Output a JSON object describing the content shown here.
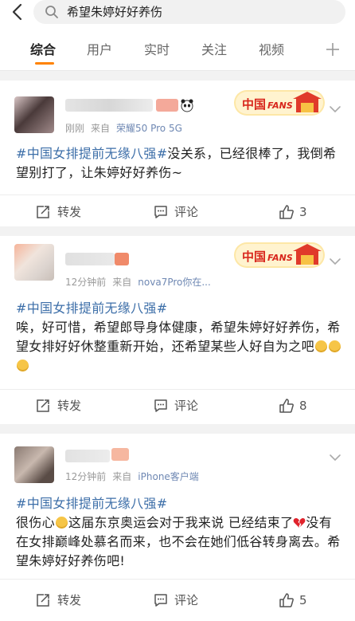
{
  "search": {
    "query": "希望朱婷好好养伤"
  },
  "tabs": [
    {
      "label": "综合",
      "active": true
    },
    {
      "label": "用户",
      "active": false
    },
    {
      "label": "实时",
      "active": false
    },
    {
      "label": "关注",
      "active": false
    },
    {
      "label": "视频",
      "active": false
    }
  ],
  "accent_color": "#ff8200",
  "hashtag_color": "#3c6ea8",
  "posts": [
    {
      "time": "刚刚",
      "source_label": "来自",
      "source": "荣耀50 Pro 5G",
      "has_fans_badge": true,
      "hashtag": "#中国女排提前无缘八强#",
      "text_after_hashtag": "没关系，已经很棒了，我倒希望别打了，让朱婷好好养伤~",
      "actions": {
        "repost": "转发",
        "comment": "评论",
        "like_count": "3"
      }
    },
    {
      "time": "12分钟前",
      "source_label": "来自",
      "source": "nova7Pro你在...",
      "has_fans_badge": true,
      "hashtag": "#中国女排提前无缘八强#",
      "text_after_hashtag": "唉，好可惜，希望郎导身体健康，希望朱婷好好养伤，希望女排好好休整重新开始，还希望某些人好自为之吧",
      "actions": {
        "repost": "转发",
        "comment": "评论",
        "like_count": "8"
      }
    },
    {
      "time": "12分钟前",
      "source_label": "来自",
      "source": "iPhone客户端",
      "has_fans_badge": false,
      "hashtag": "#中国女排提前无缘八强#",
      "text_part1": "很伤心",
      "text_part2": "这届东京奥运会对于我来说 已经结束了",
      "text_part3": "没有在女排巅峰处慕名而来，也不会在她们低谷转身离去。希望朱婷好好养伤吧!",
      "actions": {
        "repost": "转发",
        "comment": "评论",
        "like_count": "5"
      }
    }
  ],
  "fans_badge": {
    "text": "中国FANS"
  }
}
